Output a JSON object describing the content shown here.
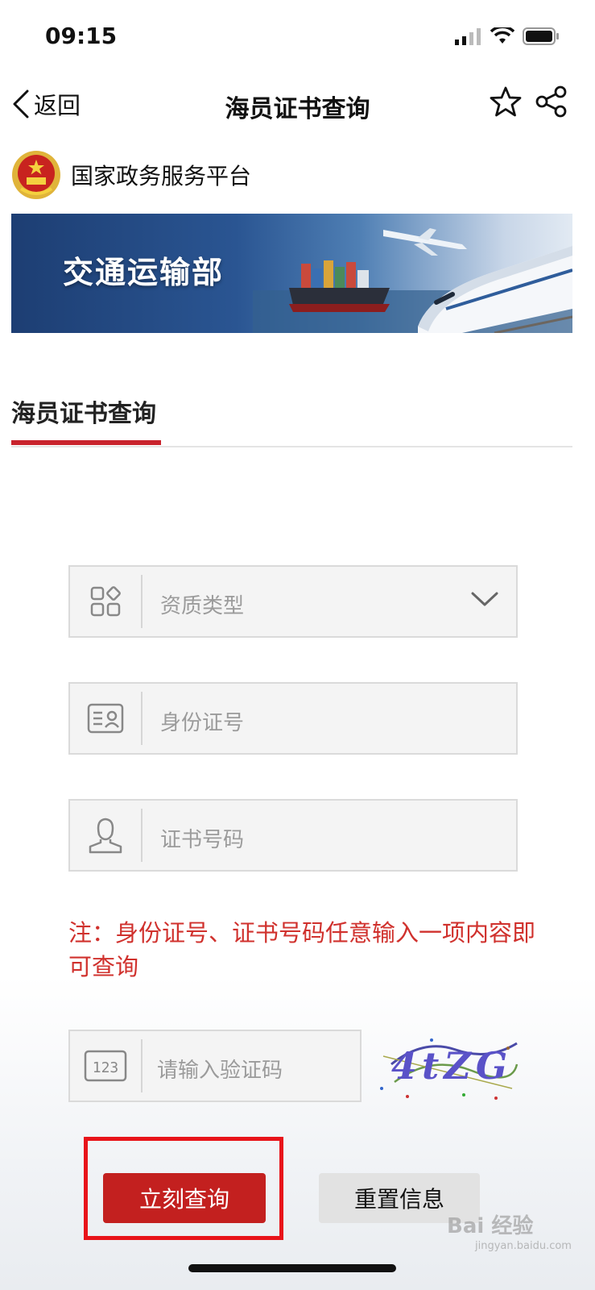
{
  "status_bar": {
    "time": "09:15"
  },
  "nav": {
    "back_label": "返回",
    "title": "海员证书查询"
  },
  "platform": {
    "name": "国家政务服务平台"
  },
  "banner": {
    "title": "交通运输部"
  },
  "tab": {
    "label": "海员证书查询"
  },
  "form": {
    "qualification_type_placeholder": "资质类型",
    "id_number_placeholder": "身份证号",
    "certificate_number_placeholder": "证书号码",
    "note": "注：身份证号、证书号码任意输入一项内容即可查询",
    "captcha_placeholder": "请输入验证码",
    "captcha_text": "4tZG"
  },
  "buttons": {
    "query": "立刻查询",
    "reset": "重置信息"
  },
  "watermark": {
    "text": "Bai 经验",
    "sub": "jingyan.baidu.com"
  },
  "colors": {
    "accent": "#c3201f",
    "note": "#d0312d",
    "highlight": "#e8141a"
  },
  "icons": [
    "back-chevron-icon",
    "star-icon",
    "share-icon",
    "emblem-icon",
    "grid-icon",
    "id-card-icon",
    "person-icon",
    "captcha-123-icon",
    "chevron-down-icon"
  ]
}
